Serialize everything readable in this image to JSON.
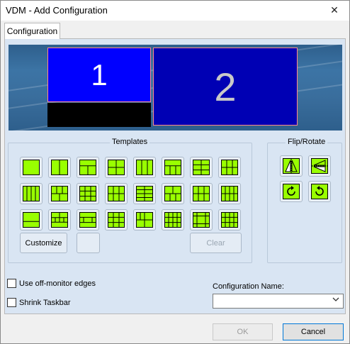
{
  "window": {
    "title": "VDM - Add Configuration",
    "close_glyph": "✕"
  },
  "tabs": [
    {
      "label": "Configuration",
      "active": true
    }
  ],
  "preview": {
    "monitors": [
      {
        "label": "1"
      },
      {
        "label": "2"
      }
    ]
  },
  "templates": {
    "label": "Templates",
    "rows": [
      [
        "layout-full",
        "layout-2col",
        "layout-1top-2bottom",
        "layout-4grid",
        "layout-3col",
        "layout-1top-3bottom",
        "layout-2col-3row",
        "layout-3col-2row"
      ],
      [
        "layout-4col",
        "layout-3top-2bottom",
        "layout-3col-3row",
        "layout-3col-2row-b",
        "layout-2col-4row",
        "layout-2top-3bottom",
        "layout-3top-3bottom",
        "layout-4col-2row"
      ],
      [
        "layout-1top-2bottom-b",
        "layout-2row-4bottom",
        "layout-center-3row",
        "layout-3x3-center",
        "layout-corner-split",
        "layout-4x4-mixed",
        "layout-center-frame",
        "layout-4x3-grid"
      ]
    ],
    "customize_label": "Customize",
    "clear_label": "Clear"
  },
  "flip_rotate": {
    "label": "Flip/Rotate",
    "buttons": [
      {
        "icon": "flip-horizontal-icon"
      },
      {
        "icon": "flip-vertical-icon"
      },
      {
        "icon": "rotate-clockwise-icon"
      },
      {
        "icon": "rotate-counterclockwise-icon"
      }
    ]
  },
  "options": {
    "off_monitor_edges_label": "Use off-monitor edges",
    "off_monitor_edges_checked": false,
    "shrink_taskbar_label": "Shrink Taskbar",
    "shrink_taskbar_checked": false
  },
  "config_name": {
    "label": "Configuration Name:",
    "value": ""
  },
  "footer": {
    "ok_label": "OK",
    "cancel_label": "Cancel"
  },
  "colors": {
    "tile_fill": "#99ff00",
    "tile_stroke": "#000000",
    "monitor1": "#0000ff",
    "monitor2": "#0000b4"
  }
}
